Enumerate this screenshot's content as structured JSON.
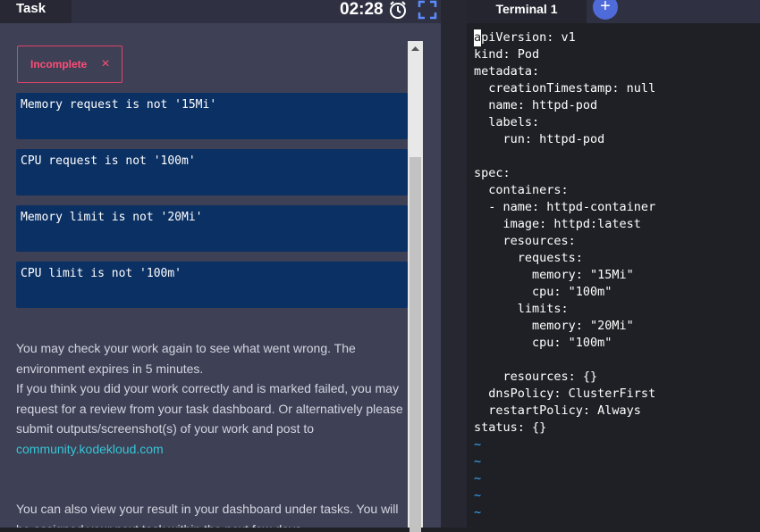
{
  "task_panel": {
    "tab_label": "Task",
    "timer": "02:28",
    "status": {
      "label": "Incomplete",
      "close": "×"
    },
    "failures": [
      "Memory request is not '15Mi'",
      "CPU request is not '100m'",
      "Memory limit is not '20Mi'",
      "CPU limit is not '100m'"
    ],
    "message_line1": "You may check your work again to see what went wrong. The environment expires in 5 minutes.",
    "message_line2": "If you think you did your work correctly and is marked failed, you may request for a review from your task dashboard. Or alternatively please submit outputs/screenshot(s) of your work and post to ",
    "message_link": "community.kodekloud.com",
    "message_line3": "You can also view your result in your dashboard under tasks. You will be assigned your next task within the next few days."
  },
  "terminal": {
    "tab_label": "Terminal 1",
    "add_label": "+",
    "cursor_char": "a",
    "lines": [
      "piVersion: v1",
      "kind: Pod",
      "metadata:",
      "  creationTimestamp: null",
      "  name: httpd-pod",
      "  labels:",
      "    run: httpd-pod",
      "",
      "spec:",
      "  containers:",
      "  - name: httpd-container",
      "    image: httpd:latest",
      "    resources:",
      "      requests:",
      "        memory: \"15Mi\"",
      "        cpu: \"100m\"",
      "      limits:",
      "        memory: \"20Mi\"",
      "        cpu: \"100m\"",
      "",
      "    resources: {}",
      "  dnsPolicy: ClusterFirst",
      "  restartPolicy: Always",
      "status: {}"
    ],
    "empty_marker": "~"
  },
  "icons": {
    "clock": "alarm-clock-icon",
    "fullscreen": "fullscreen-icon",
    "scroll_up": "arrow-up-icon"
  },
  "colors": {
    "incomplete": "#ff4d78",
    "fail_box": "#0b3063",
    "link": "#35c6d8",
    "tilde": "#38a9ff",
    "add_button": "#4f6ad9"
  }
}
